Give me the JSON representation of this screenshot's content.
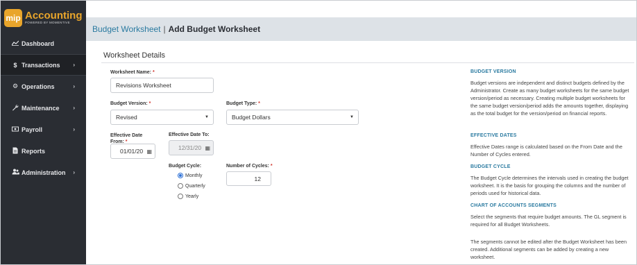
{
  "brand": {
    "logo_text": "mip",
    "name": "Accounting",
    "tagline": "POWERED BY MOMENTIVE"
  },
  "sidebar": {
    "items": [
      {
        "label": "Dashboard",
        "icon": "chart-line-icon",
        "chevron": false,
        "active": false
      },
      {
        "label": "Transactions",
        "icon": "dollar-icon",
        "chevron": true,
        "active": true
      },
      {
        "label": "Operations",
        "icon": "gears-icon",
        "chevron": true,
        "active": false
      },
      {
        "label": "Maintenance",
        "icon": "wrench-icon",
        "chevron": true,
        "active": false
      },
      {
        "label": "Payroll",
        "icon": "money-icon",
        "chevron": true,
        "active": false
      },
      {
        "label": "Reports",
        "icon": "file-icon",
        "chevron": false,
        "active": false
      },
      {
        "label": "Administration",
        "icon": "users-icon",
        "chevron": true,
        "active": false
      }
    ]
  },
  "breadcrumb": {
    "parent": "Budget Worksheet",
    "separator": "|",
    "current": "Add Budget Worksheet"
  },
  "section": {
    "title": "Worksheet Details"
  },
  "form": {
    "worksheet_name_label": "Worksheet Name:",
    "worksheet_name_value": "Revisions Worksheet",
    "budget_version_label": "Budget Version:",
    "budget_version_value": "Revised",
    "budget_type_label": "Budget Type:",
    "budget_type_value": "Budget Dollars",
    "eff_from_label_1": "Effective Date",
    "eff_from_label_2": "From:",
    "eff_from_value": "01/01/20",
    "eff_to_label": "Effective Date To:",
    "eff_to_value": "12/31/20",
    "budget_cycle_label": "Budget Cycle:",
    "cycle_options": [
      "Monthly",
      "Quarterly",
      "Yearly"
    ],
    "cycle_selected": "Monthly",
    "num_cycles_label": "Number of Cycles:",
    "num_cycles_value": "12",
    "required_marker": "*"
  },
  "help": {
    "budget_version_title": "BUDGET VERSION",
    "budget_version_text": "Budget versions are independent and distinct budgets defined by the Administrator. Create as many budget worksheets for the same budget version/period as necessary. Creating multiple budget worksheets for the same budget version/period adds the amounts together, displaying as the total budget for the version/period on financial reports.",
    "effective_dates_title": "EFFECTIVE DATES",
    "effective_dates_text": "Effective Dates range is calculated based on the From Date and the Number of Cycles entered.",
    "budget_cycle_title": "BUDGET CYCLE",
    "budget_cycle_text": "The Budget Cycle determines the intervals used in creating the budget worksheet. It is the basis for grouping the columns and the number of periods used for historical data.",
    "coa_title": "CHART OF ACCOUNTS SEGMENTS",
    "coa_text_1": "Select the segments that require budget amounts. The GL segment is required for all Budget Worksheets.",
    "coa_text_2": "The segments cannot be edited after the Budget Worksheet has been created. Additional segments can be added by creating a new worksheet."
  },
  "colors": {
    "sidebar_bg": "#2a2d33",
    "brand_accent": "#e9a52b",
    "link": "#2a7aa0",
    "header_bg": "#dde2e7",
    "required": "#d0342c"
  }
}
